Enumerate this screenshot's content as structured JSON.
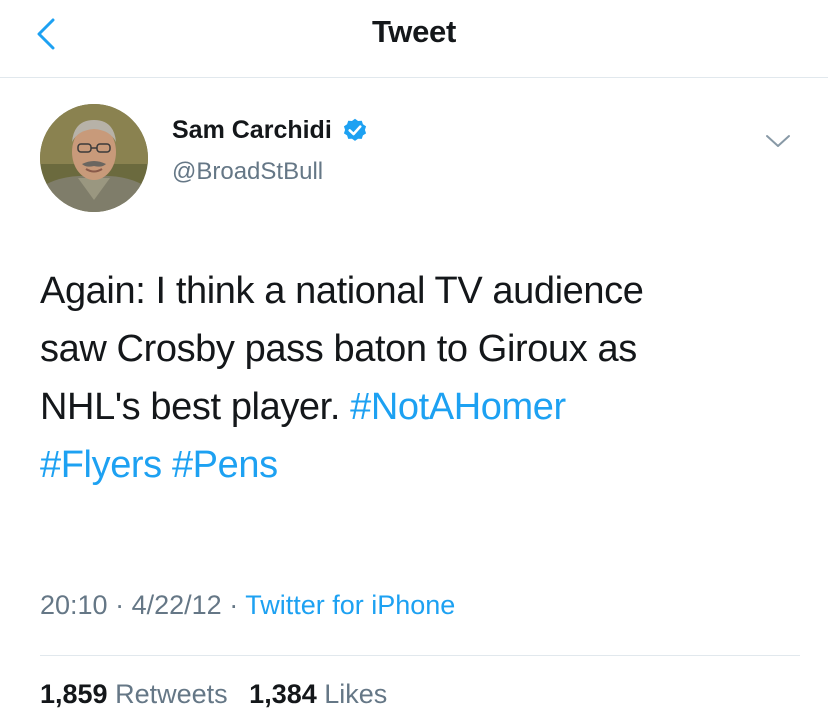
{
  "header": {
    "title": "Tweet",
    "back_icon": "chevron-left-icon"
  },
  "author": {
    "name": "Sam Carchidi",
    "handle": "@BroadStBull",
    "verified_icon": "verified-badge-icon",
    "more_icon": "chevron-down-icon"
  },
  "tweet": {
    "text_line_1": "Again: I think a national TV audience",
    "text_line_2": "saw Crosby pass baton to Giroux as",
    "text_line_3_prefix": "NHL's best player. ",
    "hashtags": [
      "#NotAHomer",
      "#Flyers",
      "#Pens"
    ]
  },
  "meta": {
    "time": "20:10",
    "date": "4/22/12",
    "separator": "·",
    "source": "Twitter for iPhone"
  },
  "stats": {
    "retweets_count": "1,859",
    "retweets_label": "Retweets",
    "likes_count": "1,384",
    "likes_label": "Likes"
  },
  "colors": {
    "accent": "#1da1f2",
    "text": "#14171a",
    "secondary": "#657786",
    "border": "#e1e8ed"
  }
}
